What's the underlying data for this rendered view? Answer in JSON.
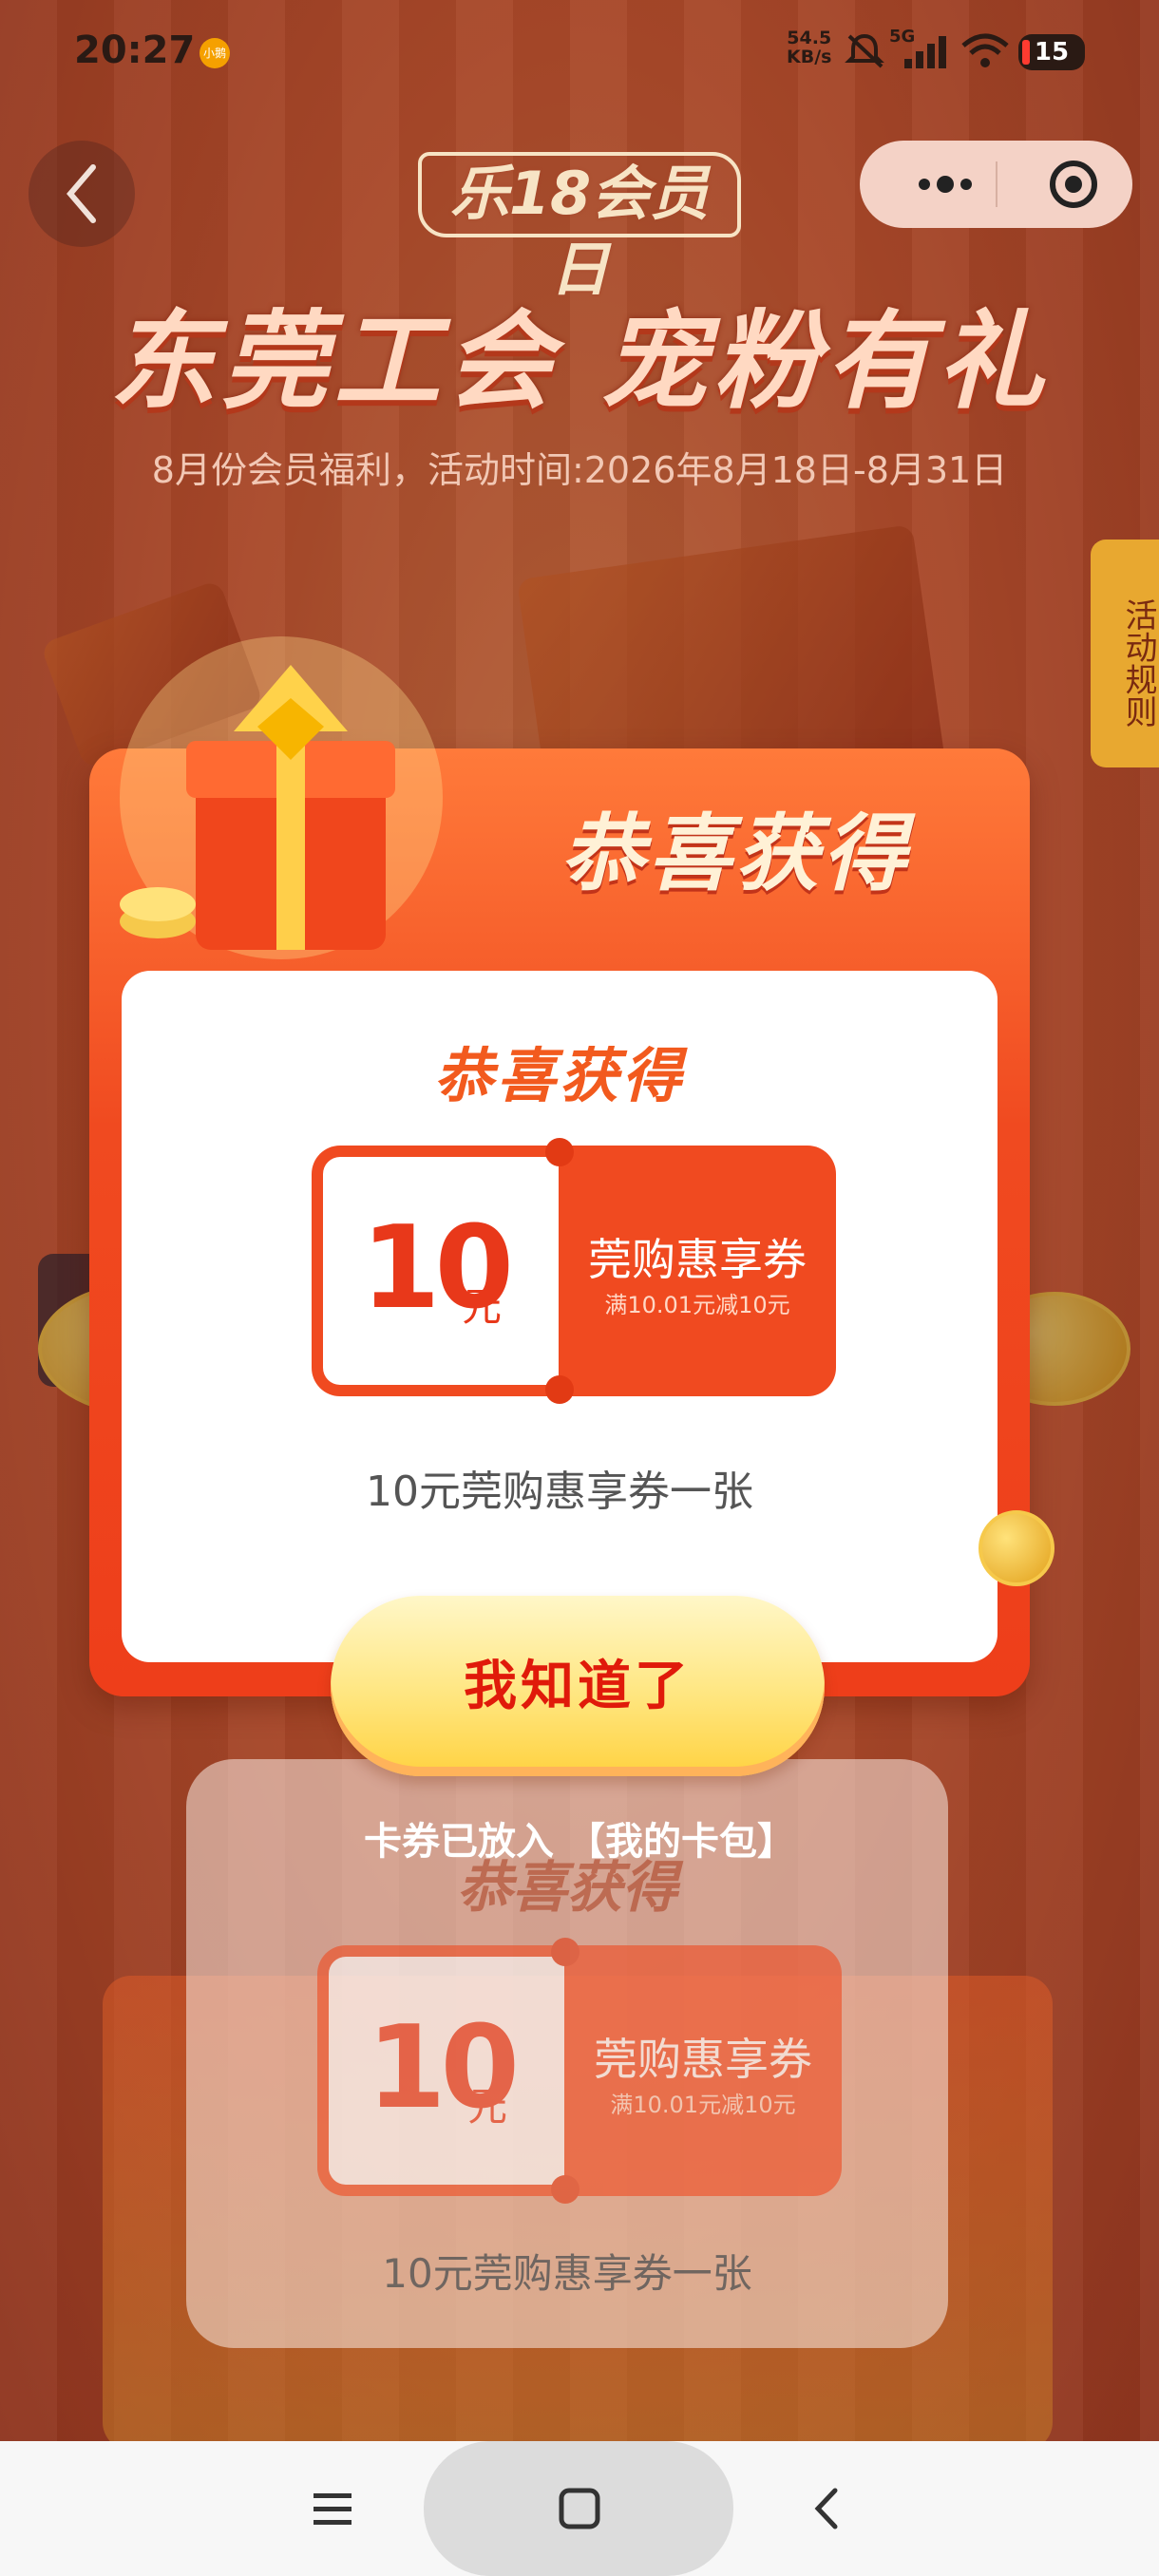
{
  "status_bar": {
    "time": "20:27",
    "app_badge": "小鹅",
    "net_speed_value": "54.5",
    "net_speed_unit": "KB/s",
    "signal_label": "5G",
    "battery": "15"
  },
  "header": {
    "logo_text": "乐18会员日",
    "main_title": "东莞工会 宠粉有礼",
    "subtitle": "8月份会员福利，活动时间:2026年8月18日-8月31日",
    "rules_tab": "活动规则"
  },
  "popup": {
    "heading": "恭喜获得",
    "inner_title": "恭喜获得",
    "coupon": {
      "amount": "10",
      "unit": "元",
      "name": "莞购惠享券",
      "rule": "满10.01元减10元"
    },
    "description": "10元莞购惠享券一张",
    "ok_button": "我知道了",
    "tip": "卡券已放入 【我的卡包】"
  },
  "background_card": {
    "title": "恭喜获得",
    "coupon": {
      "amount": "10",
      "unit": "元",
      "name": "莞购惠享券",
      "rule": "满10.01元减10元"
    },
    "description": "10元莞购惠享券一张"
  },
  "colors": {
    "brand_red": "#f04a20",
    "button_yellow": "#ffe680",
    "button_text": "#e01a0a"
  },
  "icons": [
    "back-icon",
    "more-icon",
    "target-icon",
    "mute-icon",
    "signal-icon",
    "wifi-icon",
    "menu-icon",
    "home-icon",
    "nav-back-icon"
  ]
}
